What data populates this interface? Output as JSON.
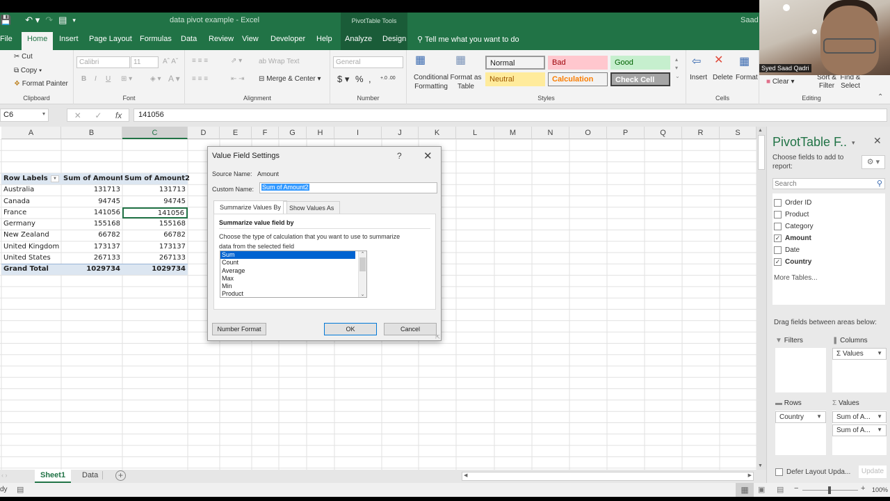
{
  "window": {
    "title": "data pivot example  -  Excel",
    "contextual_group": "PivotTable Tools",
    "user": "Saad"
  },
  "qat": {
    "save_icon": "save-icon",
    "undo_icon": "undo-icon",
    "redo_icon": "redo-icon",
    "form_icon": "form-icon"
  },
  "tabs": [
    {
      "label": "File"
    },
    {
      "label": "Home"
    },
    {
      "label": "Insert"
    },
    {
      "label": "Page Layout"
    },
    {
      "label": "Formulas"
    },
    {
      "label": "Data"
    },
    {
      "label": "Review"
    },
    {
      "label": "View"
    },
    {
      "label": "Developer"
    },
    {
      "label": "Help"
    },
    {
      "label": "Analyze"
    },
    {
      "label": "Design"
    }
  ],
  "tell_me": "Tell me what you want to do",
  "ribbon": {
    "clipboard": {
      "label": "Clipboard",
      "cut": "Cut",
      "copy": "Copy",
      "format_painter": "Format Painter"
    },
    "font": {
      "label": "Font",
      "font_name": "Calibri",
      "font_size": "11",
      "bold": "B",
      "italic": "I",
      "underline": "U"
    },
    "alignment": {
      "label": "Alignment",
      "wrap_text": "Wrap Text",
      "merge_center": "Merge & Center"
    },
    "number": {
      "label": "Number",
      "format": "General",
      "currency": "$",
      "percent": "%",
      "comma": ","
    },
    "styles": {
      "label": "Styles",
      "conditional_formatting": "Conditional Formatting",
      "format_as_table": "Format as Table",
      "cells": [
        {
          "label": "Normal",
          "bg": "#ffffff",
          "fg": "#000000"
        },
        {
          "label": "Bad",
          "bg": "#ffc7ce",
          "fg": "#9c0006"
        },
        {
          "label": "Good",
          "bg": "#c6efce",
          "fg": "#006100"
        },
        {
          "label": "Neutral",
          "bg": "#ffeb9c",
          "fg": "#9c5700"
        },
        {
          "label": "Calculation",
          "bg": "#f2f2f2",
          "fg": "#fa7d00"
        },
        {
          "label": "Check Cell",
          "bg": "#a5a5a5",
          "fg": "#ffffff"
        }
      ]
    },
    "cells": {
      "label": "Cells",
      "insert": "Insert",
      "delete": "Delete",
      "format": "Format"
    },
    "editing": {
      "label": "Editing",
      "clear": "Clear",
      "sort_filter": "Sort & Filter",
      "find_select": "Find & Select"
    }
  },
  "formula_bar": {
    "name_box": "C6",
    "value": "141056"
  },
  "columns": [
    "A",
    "B",
    "C",
    "D",
    "E",
    "F",
    "G",
    "H",
    "I",
    "J",
    "K",
    "L",
    "M",
    "N",
    "O",
    "P",
    "Q",
    "R",
    "S"
  ],
  "pivot": {
    "headers": [
      "Row Labels",
      "Sum of Amount",
      "Sum of Amount2"
    ],
    "rows": [
      {
        "label": "Australia",
        "amount": "131713",
        "amount2": "131713"
      },
      {
        "label": "Canada",
        "amount": "94745",
        "amount2": "94745"
      },
      {
        "label": "France",
        "amount": "141056",
        "amount2": "141056"
      },
      {
        "label": "Germany",
        "amount": "155168",
        "amount2": "155168"
      },
      {
        "label": "New Zealand",
        "amount": "66782",
        "amount2": "66782"
      },
      {
        "label": "United Kingdom",
        "amount": "173137",
        "amount2": "173137"
      },
      {
        "label": "United States",
        "amount": "267133",
        "amount2": "267133"
      }
    ],
    "total": {
      "label": "Grand Total",
      "amount": "1029734",
      "amount2": "1029734"
    }
  },
  "dialog": {
    "title": "Value Field Settings",
    "help": "?",
    "source_name_label": "Source Name:",
    "source_name": "Amount",
    "custom_name_label": "Custom Name:",
    "custom_name": "Sum of Amount2",
    "tabs": [
      "Summarize Values By",
      "Show Values As"
    ],
    "section_title": "Summarize value field by",
    "description": "Choose the type of calculation that you want to use to summarize data from the selected field",
    "functions": [
      "Sum",
      "Count",
      "Average",
      "Max",
      "Min",
      "Product"
    ],
    "selected_function": "Sum",
    "number_format": "Number Format",
    "ok": "OK",
    "cancel": "Cancel"
  },
  "pane": {
    "title": "PivotTable F..",
    "subtitle": "Choose fields to add to report:",
    "search_placeholder": "Search",
    "fields": [
      {
        "name": "Order ID",
        "checked": false
      },
      {
        "name": "Product",
        "checked": false
      },
      {
        "name": "Category",
        "checked": false
      },
      {
        "name": "Amount",
        "checked": true
      },
      {
        "name": "Date",
        "checked": false
      },
      {
        "name": "Country",
        "checked": true
      }
    ],
    "more_tables": "More Tables...",
    "drag_hint": "Drag fields between areas below:",
    "filters_label": "Filters",
    "columns_label": "Columns",
    "rows_label": "Rows",
    "values_label": "Values",
    "columns_items": [
      "Σ Values"
    ],
    "rows_items": [
      "Country"
    ],
    "values_items": [
      "Sum of A...",
      "Sum of A..."
    ],
    "defer": "Defer Layout Upda...",
    "update": "Update"
  },
  "sheets": [
    {
      "name": "Sheet1",
      "active": true
    },
    {
      "name": "Data",
      "active": false
    }
  ],
  "status": {
    "ready": "dy",
    "zoom": "100%"
  },
  "video": {
    "name": "Syed Saad Qadri"
  }
}
